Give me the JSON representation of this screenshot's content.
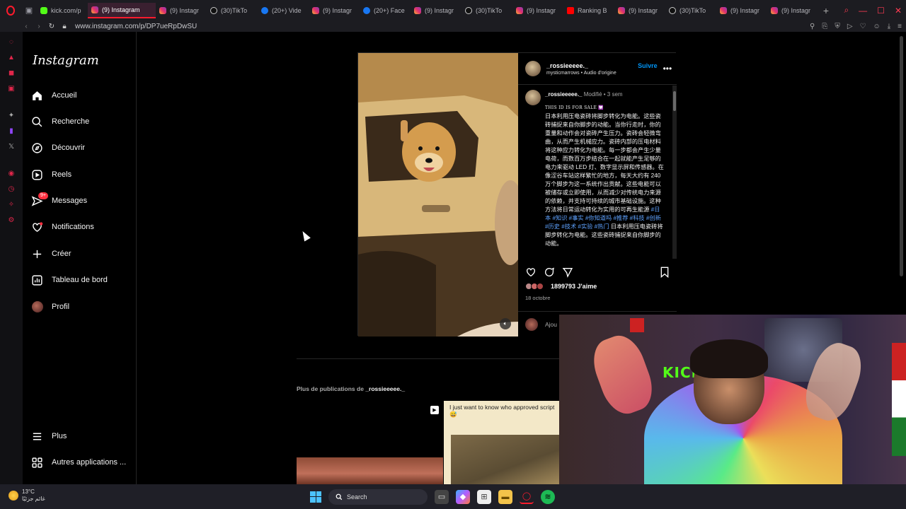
{
  "browser": {
    "tabs": [
      {
        "label": "kick.com/p",
        "icon": "kick-icon"
      },
      {
        "label": "(9) Instagram",
        "icon": "instagram-icon",
        "active": true
      },
      {
        "label": "(9) Instagr",
        "icon": "instagram-icon"
      },
      {
        "label": "(30)TikTo",
        "icon": "tiktok-icon"
      },
      {
        "label": "(20+) Vide",
        "icon": "facebook-icon"
      },
      {
        "label": "(9) Instagr",
        "icon": "instagram-icon"
      },
      {
        "label": "(20+) Face",
        "icon": "facebook-icon"
      },
      {
        "label": "(9) Instagr",
        "icon": "instagram-icon"
      },
      {
        "label": "(30)TikTo",
        "icon": "tiktok-icon"
      },
      {
        "label": "(9) Instagr",
        "icon": "instagram-icon"
      },
      {
        "label": "Ranking B",
        "icon": "youtube-icon"
      },
      {
        "label": "(9) Instagr",
        "icon": "instagram-icon"
      },
      {
        "label": "(30)TikTo",
        "icon": "tiktok-icon"
      },
      {
        "label": "(9) Instagr",
        "icon": "instagram-icon"
      },
      {
        "label": "(9) Instagr",
        "icon": "instagram-icon"
      }
    ],
    "url": "www.instagram.com/p/DP7ueRpDwSU"
  },
  "instagram": {
    "logo": "Instagram",
    "nav": [
      {
        "key": "home",
        "label": "Accueil"
      },
      {
        "key": "search",
        "label": "Recherche"
      },
      {
        "key": "explore",
        "label": "Découvrir"
      },
      {
        "key": "reels",
        "label": "Reels"
      },
      {
        "key": "messages",
        "label": "Messages",
        "badge": "9+"
      },
      {
        "key": "notifications",
        "label": "Notifications"
      },
      {
        "key": "create",
        "label": "Créer"
      },
      {
        "key": "dashboard",
        "label": "Tableau de bord"
      },
      {
        "key": "profile",
        "label": "Profil"
      }
    ],
    "more": "Plus",
    "other_apps": "Autres applications ..."
  },
  "post": {
    "username": "_rossieeeee._",
    "follow": "Suivre",
    "audio": "mysticmarrows • Audio d'origine",
    "modified": "Modifié •",
    "age": "3 sem",
    "caption_header": "THIS ID IS FOR SALE 💟",
    "caption": "日本利用压电瓷砖将脚步转化为电能。这些瓷砖捕捉来自你脚步的动能。当你行走时，你的重量和动作会对瓷砖产生压力。瓷砖会轻微弯曲，从而产生机械应力。瓷砖内部的压电材料将这种应力转化为电能。每一步都会产生少量电荷，而数百万步结合在一起就能产生足够的电力来驱动 LED 灯、数字显示屏和传感器。在像涩谷车站这样繁忙的地方，每天大约有 240 万个脚步为这一系统作出贡献。这些电能可以被储存或立即使用，从而减少对传统电力来源的依赖，并支持可持续的城市基础设施。这种方法将日常运动转化为实用的可再生能源",
    "tags": "#日本 #知识 #事实 #你知道吗 #推荐 #科技 #创新 #历史 #技术 #实验 #热门",
    "caption_tail": "日本利用压电瓷砖将脚步转化为电能。这些瓷砖捕捉来自你脚步的动能。",
    "likes": "1899793 J'aime",
    "date": "18 octobre",
    "add_comment": "Ajou"
  },
  "more_posts": {
    "prefix": "Plus de publications de",
    "username": "_rossieeeee._",
    "thumb2_text": "I just want to know who approved script 😅"
  },
  "webcam": {
    "sign": "KICK"
  },
  "taskbar": {
    "temp": "13°C",
    "weather": "غائم جزئيًا",
    "search": "Search"
  },
  "colors": {
    "accent": "#0095f6",
    "opera": "#ff1b2d",
    "badge": "#ff3040",
    "kick": "#53fc18"
  }
}
